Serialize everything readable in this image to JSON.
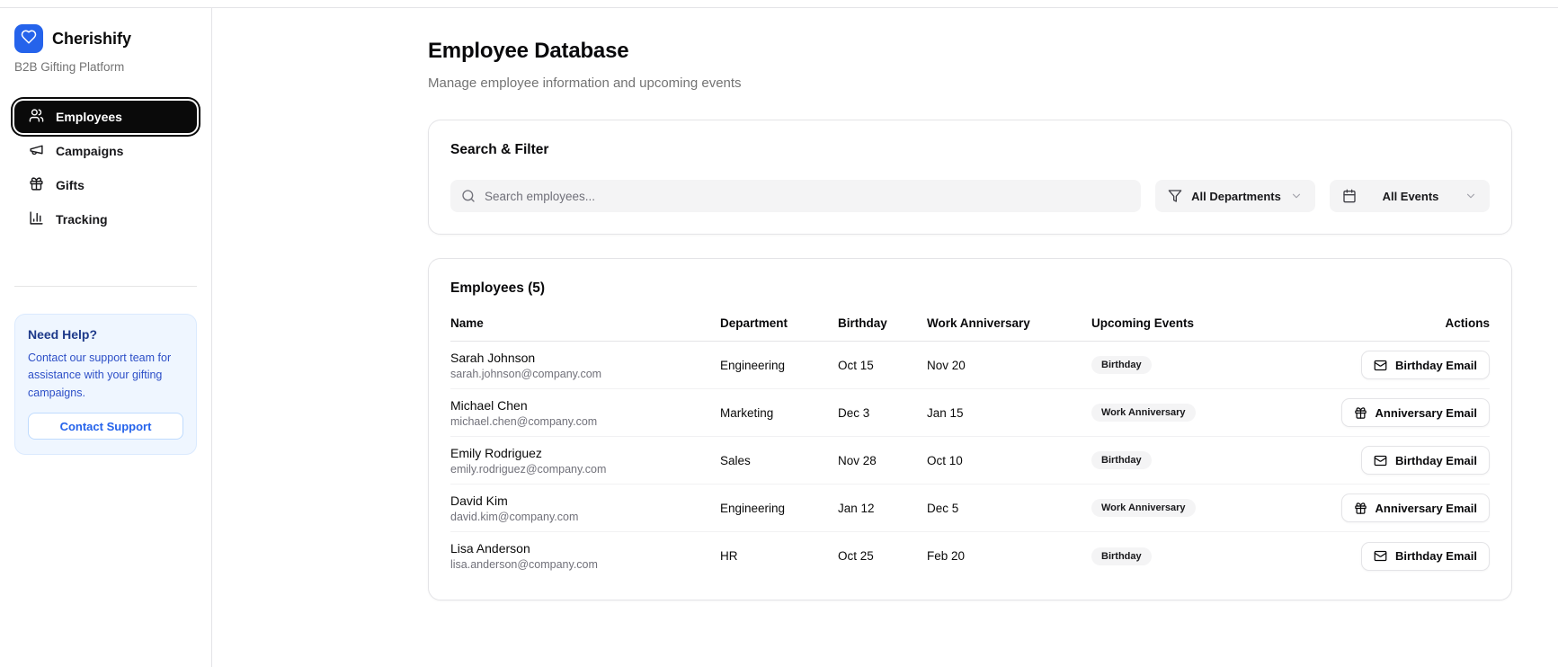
{
  "sidebar": {
    "brand": {
      "name": "Cherishify",
      "tagline": "B2B Gifting Platform"
    },
    "nav": [
      {
        "label": "Employees",
        "icon": "users-icon",
        "active": true
      },
      {
        "label": "Campaigns",
        "icon": "megaphone-icon",
        "active": false
      },
      {
        "label": "Gifts",
        "icon": "gift-icon",
        "active": false
      },
      {
        "label": "Tracking",
        "icon": "bar-chart-icon",
        "active": false
      }
    ],
    "help": {
      "title": "Need Help?",
      "body": "Contact our support team for assistance with your gifting campaigns.",
      "button": "Contact Support"
    }
  },
  "header": {
    "title": "Employee Database",
    "subtitle": "Manage employee information and upcoming events"
  },
  "filters": {
    "card_title": "Search & Filter",
    "search_placeholder": "Search employees...",
    "department_filter": "All Departments",
    "event_filter": "All Events"
  },
  "employees": {
    "card_title": "Employees (5)",
    "columns": {
      "name": "Name",
      "department": "Department",
      "birthday": "Birthday",
      "anniversary": "Work Anniversary",
      "events": "Upcoming Events",
      "actions": "Actions"
    },
    "rows": [
      {
        "name": "Sarah Johnson",
        "email": "sarah.johnson@company.com",
        "department": "Engineering",
        "birthday": "Oct 15",
        "anniversary": "Nov 20",
        "event": "Birthday",
        "action": "Birthday Email",
        "action_icon": "mail-icon"
      },
      {
        "name": "Michael Chen",
        "email": "michael.chen@company.com",
        "department": "Marketing",
        "birthday": "Dec 3",
        "anniversary": "Jan 15",
        "event": "Work Anniversary",
        "action": "Anniversary Email",
        "action_icon": "gift-icon"
      },
      {
        "name": "Emily Rodriguez",
        "email": "emily.rodriguez@company.com",
        "department": "Sales",
        "birthday": "Nov 28",
        "anniversary": "Oct 10",
        "event": "Birthday",
        "action": "Birthday Email",
        "action_icon": "mail-icon"
      },
      {
        "name": "David Kim",
        "email": "david.kim@company.com",
        "department": "Engineering",
        "birthday": "Jan 12",
        "anniversary": "Dec 5",
        "event": "Work Anniversary",
        "action": "Anniversary Email",
        "action_icon": "gift-icon"
      },
      {
        "name": "Lisa Anderson",
        "email": "lisa.anderson@company.com",
        "department": "HR",
        "birthday": "Oct 25",
        "anniversary": "Feb 20",
        "event": "Birthday",
        "action": "Birthday Email",
        "action_icon": "mail-icon"
      }
    ]
  },
  "colors": {
    "brand_blue": "#2563eb",
    "active_nav_bg": "#0a0a0a",
    "help_card_bg": "#eff6ff",
    "help_title_text": "#1e3a8a",
    "muted_text": "#737373",
    "badge_bg": "#f4f4f5",
    "border": "#e4e4e7"
  }
}
